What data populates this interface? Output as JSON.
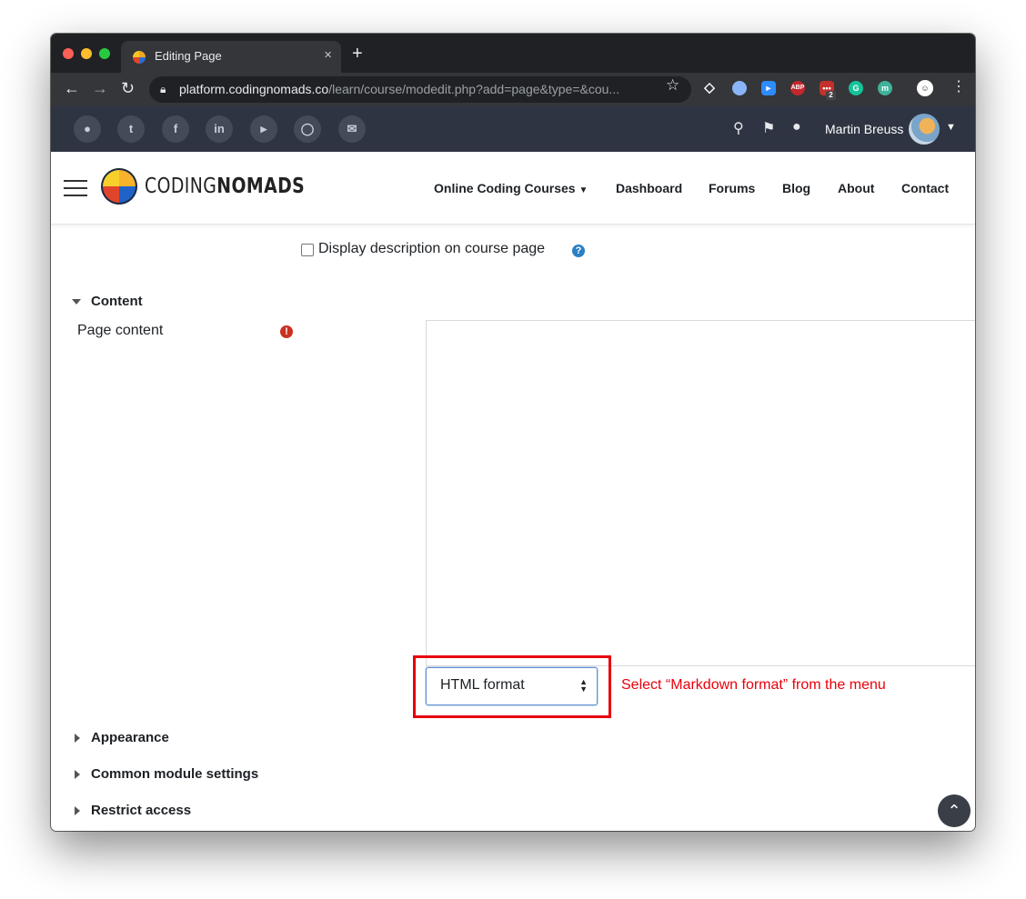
{
  "browser": {
    "tab_title": "Editing Page",
    "tab_close": "×",
    "new_tab": "+",
    "url_host": "platform.codingnomads.co",
    "url_path": "/learn/course/modedit.php?add=page&type=&cou...",
    "extension_badge": "2"
  },
  "site_bar": {
    "social_icons": [
      "globe-icon",
      "twitter-icon",
      "facebook-icon",
      "linkedin-icon",
      "youtube-icon",
      "instagram-icon",
      "mail-icon"
    ],
    "username": "Martin Breuss"
  },
  "navbar": {
    "logo_light": "CODING",
    "logo_bold": "NOMADS",
    "links": [
      "Online Coding Courses",
      "Dashboard",
      "Forums",
      "Blog",
      "About",
      "Contact"
    ]
  },
  "form": {
    "display_description_label": "Display description on course page",
    "content_section": "Content",
    "page_content_label": "Page content",
    "format_value": "HTML format",
    "annotation": "Select “Markdown format” from the menu",
    "sections": [
      "Appearance",
      "Common module settings",
      "Restrict access"
    ]
  },
  "colors": {
    "site_bar_bg": "#2e3442",
    "annotation_red": "#e8000b",
    "required_red": "#ca3120",
    "help_blue": "#2a80c3"
  }
}
